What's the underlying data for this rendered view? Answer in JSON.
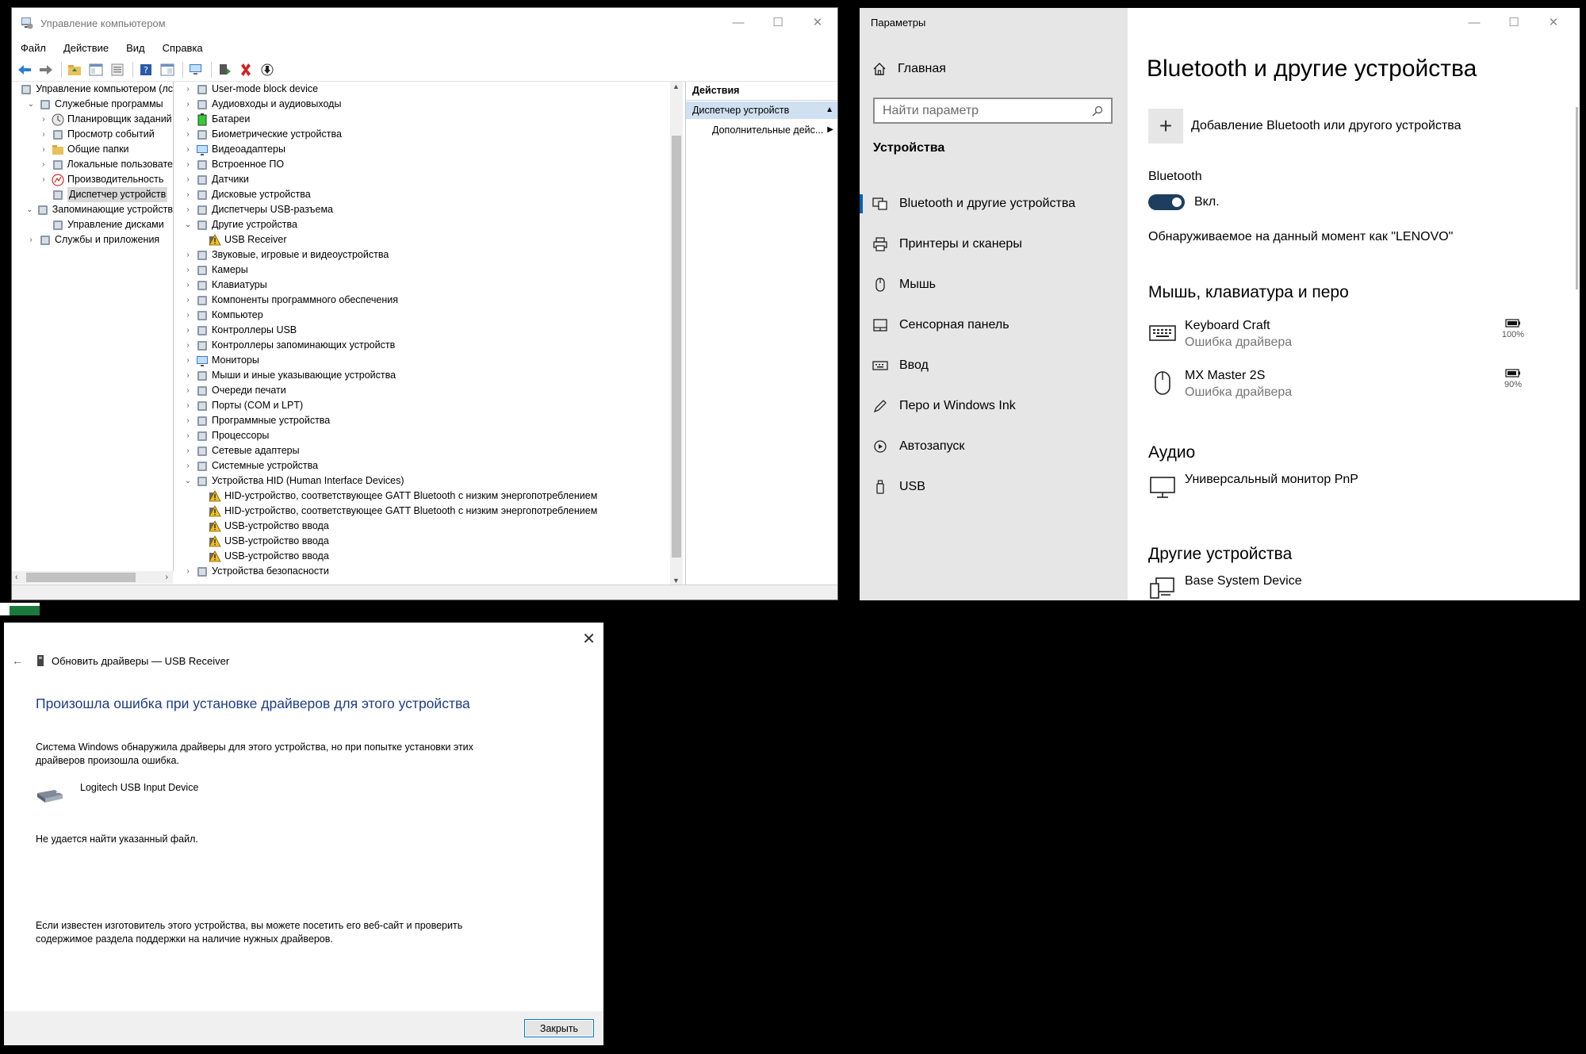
{
  "computer_management": {
    "title": "Управление компьютером",
    "menu": [
      "Файл",
      "Действие",
      "Вид",
      "Справка"
    ],
    "tree": [
      {
        "label": "Управление компьютером (лс",
        "indent": 0,
        "arrow": "",
        "icon": "computer-management-icon"
      },
      {
        "label": "Служебные программы",
        "indent": 1,
        "arrow": "⌄",
        "icon": "tools-icon"
      },
      {
        "label": "Планировщик заданий",
        "indent": 2,
        "arrow": "›",
        "icon": "clock-icon"
      },
      {
        "label": "Просмотр событий",
        "indent": 2,
        "arrow": "›",
        "icon": "event-viewer-icon"
      },
      {
        "label": "Общие папки",
        "indent": 2,
        "arrow": "›",
        "icon": "shared-folder-icon"
      },
      {
        "label": "Локальные пользовате",
        "indent": 2,
        "arrow": "›",
        "icon": "users-icon"
      },
      {
        "label": "Производительность",
        "indent": 2,
        "arrow": "›",
        "icon": "performance-icon"
      },
      {
        "label": "Диспетчер устройств",
        "indent": 2,
        "arrow": "",
        "icon": "device-manager-icon",
        "selected": true
      },
      {
        "label": "Запоминающие устройств",
        "indent": 1,
        "arrow": "⌄",
        "icon": "storage-icon"
      },
      {
        "label": "Управление дисками",
        "indent": 2,
        "arrow": "",
        "icon": "disk-management-icon"
      },
      {
        "label": "Службы и приложения",
        "indent": 1,
        "arrow": "›",
        "icon": "services-icon"
      }
    ],
    "devices": [
      {
        "label": "User-mode block device",
        "indent": 0,
        "arrow": "›",
        "icon": "block-device-icon"
      },
      {
        "label": "Аудиовходы и аудиовыходы",
        "indent": 0,
        "arrow": "›",
        "icon": "speaker-icon"
      },
      {
        "label": "Батареи",
        "indent": 0,
        "arrow": "›",
        "icon": "battery-icon"
      },
      {
        "label": "Биометрические устройства",
        "indent": 0,
        "arrow": "›",
        "icon": "biometric-icon"
      },
      {
        "label": "Видеоадаптеры",
        "indent": 0,
        "arrow": "›",
        "icon": "display-adapter-icon"
      },
      {
        "label": "Встроенное ПО",
        "indent": 0,
        "arrow": "›",
        "icon": "firmware-icon"
      },
      {
        "label": "Датчики",
        "indent": 0,
        "arrow": "›",
        "icon": "sensor-icon"
      },
      {
        "label": "Дисковые устройства",
        "indent": 0,
        "arrow": "›",
        "icon": "disk-drive-icon"
      },
      {
        "label": "Диспетчеры USB-разъема",
        "indent": 0,
        "arrow": "›",
        "icon": "usb-connector-icon"
      },
      {
        "label": "Другие устройства",
        "indent": 0,
        "arrow": "⌄",
        "icon": "other-devices-icon"
      },
      {
        "label": "USB Receiver",
        "indent": 1,
        "arrow": "",
        "icon": "unknown-device-warning-icon"
      },
      {
        "label": "Звуковые, игровые и видеоустройства",
        "indent": 0,
        "arrow": "›",
        "icon": "sound-icon"
      },
      {
        "label": "Камеры",
        "indent": 0,
        "arrow": "›",
        "icon": "camera-icon"
      },
      {
        "label": "Клавиатуры",
        "indent": 0,
        "arrow": "›",
        "icon": "keyboard-icon"
      },
      {
        "label": "Компоненты программного обеспечения",
        "indent": 0,
        "arrow": "›",
        "icon": "software-component-icon"
      },
      {
        "label": "Компьютер",
        "indent": 0,
        "arrow": "›",
        "icon": "computer-icon"
      },
      {
        "label": "Контроллеры USB",
        "indent": 0,
        "arrow": "›",
        "icon": "usb-icon"
      },
      {
        "label": "Контроллеры запоминающих устройств",
        "indent": 0,
        "arrow": "›",
        "icon": "storage-controller-icon"
      },
      {
        "label": "Мониторы",
        "indent": 0,
        "arrow": "›",
        "icon": "monitor-icon"
      },
      {
        "label": "Мыши и иные указывающие устройства",
        "indent": 0,
        "arrow": "›",
        "icon": "mouse-icon"
      },
      {
        "label": "Очереди печати",
        "indent": 0,
        "arrow": "›",
        "icon": "printer-icon"
      },
      {
        "label": "Порты (COM и LPT)",
        "indent": 0,
        "arrow": "›",
        "icon": "port-icon"
      },
      {
        "label": "Программные устройства",
        "indent": 0,
        "arrow": "›",
        "icon": "software-device-icon"
      },
      {
        "label": "Процессоры",
        "indent": 0,
        "arrow": "›",
        "icon": "processor-icon"
      },
      {
        "label": "Сетевые адаптеры",
        "indent": 0,
        "arrow": "›",
        "icon": "network-adapter-icon"
      },
      {
        "label": "Системные устройства",
        "indent": 0,
        "arrow": "›",
        "icon": "system-device-icon"
      },
      {
        "label": "Устройства HID (Human Interface Devices)",
        "indent": 0,
        "arrow": "⌄",
        "icon": "hid-icon"
      },
      {
        "label": "HID-устройство, соответствующее GATT Bluetooth с низким энергопотреблением",
        "indent": 1,
        "arrow": "",
        "icon": "hid-warning-icon"
      },
      {
        "label": "HID-устройство, соответствующее GATT Bluetooth с низким энергопотреблением",
        "indent": 1,
        "arrow": "",
        "icon": "hid-warning-icon"
      },
      {
        "label": "USB-устройство ввода",
        "indent": 1,
        "arrow": "",
        "icon": "hid-warning-icon"
      },
      {
        "label": "USB-устройство ввода",
        "indent": 1,
        "arrow": "",
        "icon": "hid-warning-icon"
      },
      {
        "label": "USB-устройство ввода",
        "indent": 1,
        "arrow": "",
        "icon": "hid-warning-icon"
      },
      {
        "label": "Устройства безопасности",
        "indent": 0,
        "arrow": "›",
        "icon": "security-device-icon"
      }
    ],
    "actions_header": "Действия",
    "actions_selected": "Диспетчер устройств",
    "actions_more": "Дополнительные дейс..."
  },
  "settings": {
    "app_title": "Параметры",
    "home": "Главная",
    "search_placeholder": "Найти параметр",
    "section": "Устройства",
    "nav": [
      {
        "label": "Bluetooth и другие устройства",
        "icon": "bluetooth-devices-icon",
        "active": true
      },
      {
        "label": "Принтеры и сканеры",
        "icon": "printer-icon"
      },
      {
        "label": "Мышь",
        "icon": "mouse-icon"
      },
      {
        "label": "Сенсорная панель",
        "icon": "touchpad-icon"
      },
      {
        "label": "Ввод",
        "icon": "keyboard-icon"
      },
      {
        "label": "Перо и Windows Ink",
        "icon": "pen-icon"
      },
      {
        "label": "Автозапуск",
        "icon": "autoplay-icon"
      },
      {
        "label": "USB",
        "icon": "usb-icon"
      }
    ],
    "page_title": "Bluetooth и другие устройства",
    "add_device": "Добавление Bluetooth или другого устройства",
    "bluetooth_label": "Bluetooth",
    "toggle_state": "Вкл.",
    "discoverable": "Обнаруживаемое на данный момент как \"LENOVO\"",
    "group_mouse": "Мышь, клавиатура и перо",
    "keyboard": {
      "name": "Keyboard Craft",
      "status": "Ошибка драйвера",
      "battery": "100%"
    },
    "mouse": {
      "name": "MX Master 2S",
      "status": "Ошибка драйвера",
      "battery": "90%"
    },
    "group_audio": "Аудио",
    "monitor": {
      "name": "Универсальный монитор PnP"
    },
    "group_other": "Другие устройства",
    "base_device": {
      "name": "Base System Device"
    }
  },
  "update_dialog": {
    "crumb": "Обновить драйверы — USB Receiver",
    "heading": "Произошла ошибка при установке драйверов для этого устройства",
    "p1_line1": "Система Windows обнаружила драйверы для этого устройства, но при попытке установки этих",
    "p1_line2": "драйверов произошла ошибка.",
    "device": "Logitech USB Input Device",
    "error": "Не удается найти указанный файл.",
    "p2_line1": "Если известен изготовитель этого устройства, вы можете посетить его веб-сайт и проверить",
    "p2_line2": "содержимое раздела поддержки на наличие нужных драйверов.",
    "close_button": "Закрыть"
  }
}
